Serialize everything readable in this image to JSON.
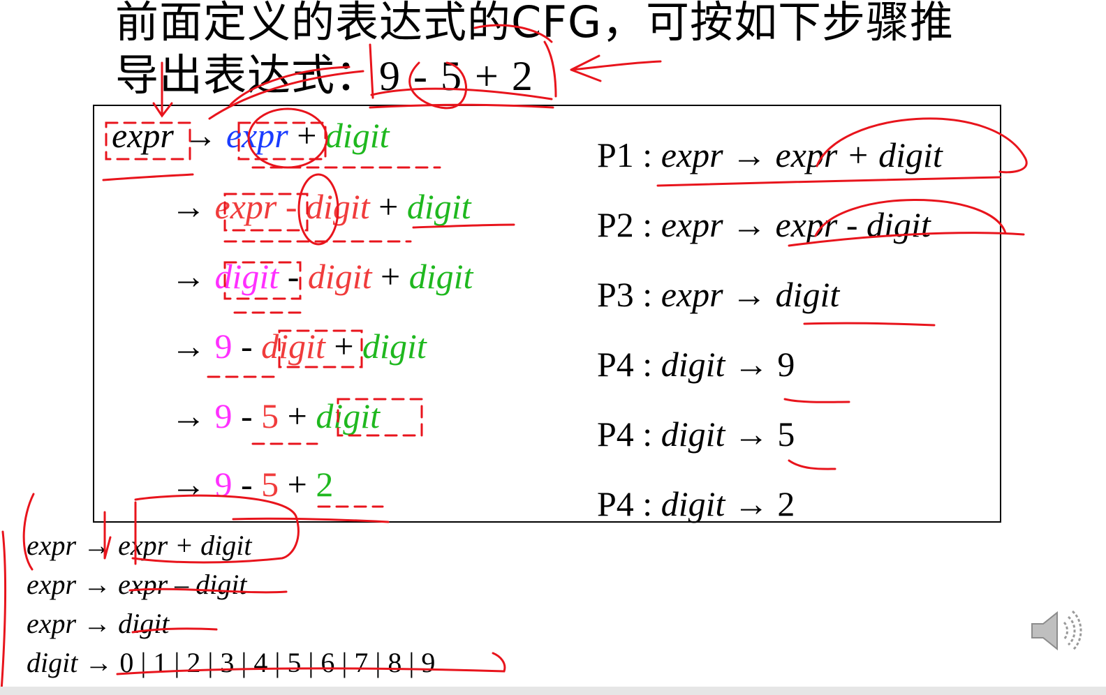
{
  "slide": {
    "title_line1": "前面定义的表达式的CFG，可按如下步骤推",
    "title_line2_prefix": "导出表达式：",
    "title_expression": "9 - 5 + 2"
  },
  "derivation": {
    "arrow": "→",
    "steps": [
      [
        {
          "text": "expr",
          "style": "italic",
          "color": "black"
        },
        {
          "text": " → ",
          "style": "normal",
          "color": "black"
        },
        {
          "text": "expr",
          "style": "italic",
          "color": "blue"
        },
        {
          "text": " + ",
          "style": "normal",
          "color": "black"
        },
        {
          "text": "digit",
          "style": "italic",
          "color": "green"
        }
      ],
      [
        {
          "text": "→ ",
          "style": "normal",
          "color": "black"
        },
        {
          "text": "expr - digit",
          "style": "italic",
          "color": "red"
        },
        {
          "text": " + ",
          "style": "normal",
          "color": "black"
        },
        {
          "text": "digit",
          "style": "italic",
          "color": "green"
        }
      ],
      [
        {
          "text": "→ ",
          "style": "normal",
          "color": "black"
        },
        {
          "text": "digit",
          "style": "italic",
          "color": "magenta"
        },
        {
          "text": " - ",
          "style": "normal",
          "color": "black"
        },
        {
          "text": "digit",
          "style": "italic",
          "color": "red"
        },
        {
          "text": " + ",
          "style": "normal",
          "color": "black"
        },
        {
          "text": "digit",
          "style": "italic",
          "color": "green"
        }
      ],
      [
        {
          "text": "→ ",
          "style": "normal",
          "color": "black"
        },
        {
          "text": "9",
          "style": "normal",
          "color": "magenta"
        },
        {
          "text": " - ",
          "style": "normal",
          "color": "black"
        },
        {
          "text": "digit",
          "style": "italic",
          "color": "red"
        },
        {
          "text": " + ",
          "style": "normal",
          "color": "black"
        },
        {
          "text": "digit",
          "style": "italic",
          "color": "green"
        }
      ],
      [
        {
          "text": "→ ",
          "style": "normal",
          "color": "black"
        },
        {
          "text": "9",
          "style": "normal",
          "color": "magenta"
        },
        {
          "text": " - ",
          "style": "normal",
          "color": "black"
        },
        {
          "text": "5",
          "style": "normal",
          "color": "red"
        },
        {
          "text": " + ",
          "style": "normal",
          "color": "black"
        },
        {
          "text": "digit",
          "style": "italic",
          "color": "green"
        }
      ],
      [
        {
          "text": "→ ",
          "style": "normal",
          "color": "black"
        },
        {
          "text": "9",
          "style": "normal",
          "color": "magenta"
        },
        {
          "text": " - ",
          "style": "normal",
          "color": "black"
        },
        {
          "text": "5",
          "style": "normal",
          "color": "red"
        },
        {
          "text": " + ",
          "style": "normal",
          "color": "black"
        },
        {
          "text": "2",
          "style": "normal",
          "color": "green"
        }
      ]
    ]
  },
  "productions": [
    {
      "label": "P1 : ",
      "lhs": "expr",
      "arrow": " → ",
      "rhs": "expr + digit"
    },
    {
      "label": "P2 : ",
      "lhs": "expr",
      "arrow": " → ",
      "rhs": "expr - digit"
    },
    {
      "label": "P3 : ",
      "lhs": "expr",
      "arrow": " → ",
      "rhs": "digit"
    },
    {
      "label": "P4 : ",
      "lhs": "digit",
      "arrow": " → ",
      "rhs": "9"
    },
    {
      "label": "P4 : ",
      "lhs": "digit",
      "arrow": " → ",
      "rhs": "5"
    },
    {
      "label": "P4 : ",
      "lhs": "digit",
      "arrow": " → ",
      "rhs": "2"
    }
  ],
  "grammar": [
    {
      "lhs": "expr",
      "arrow": " → ",
      "rhs": "expr + digit"
    },
    {
      "lhs": "expr",
      "arrow": " → ",
      "rhs": "expr – digit"
    },
    {
      "lhs": "expr",
      "arrow": " → ",
      "rhs": "digit"
    },
    {
      "lhs": "digit",
      "arrow": " → ",
      "rhs": "0 | 1 | 2 | 3 | 4 | 5 | 6 | 7 | 8 | 9"
    }
  ],
  "colors": {
    "black": "#000000",
    "blue": "#1a3cff",
    "green": "#1fb81f",
    "red": "#f03c3c",
    "magenta": "#ff30ff",
    "pen": "#e8141c"
  },
  "icons": {
    "audio": "speaker-icon"
  }
}
